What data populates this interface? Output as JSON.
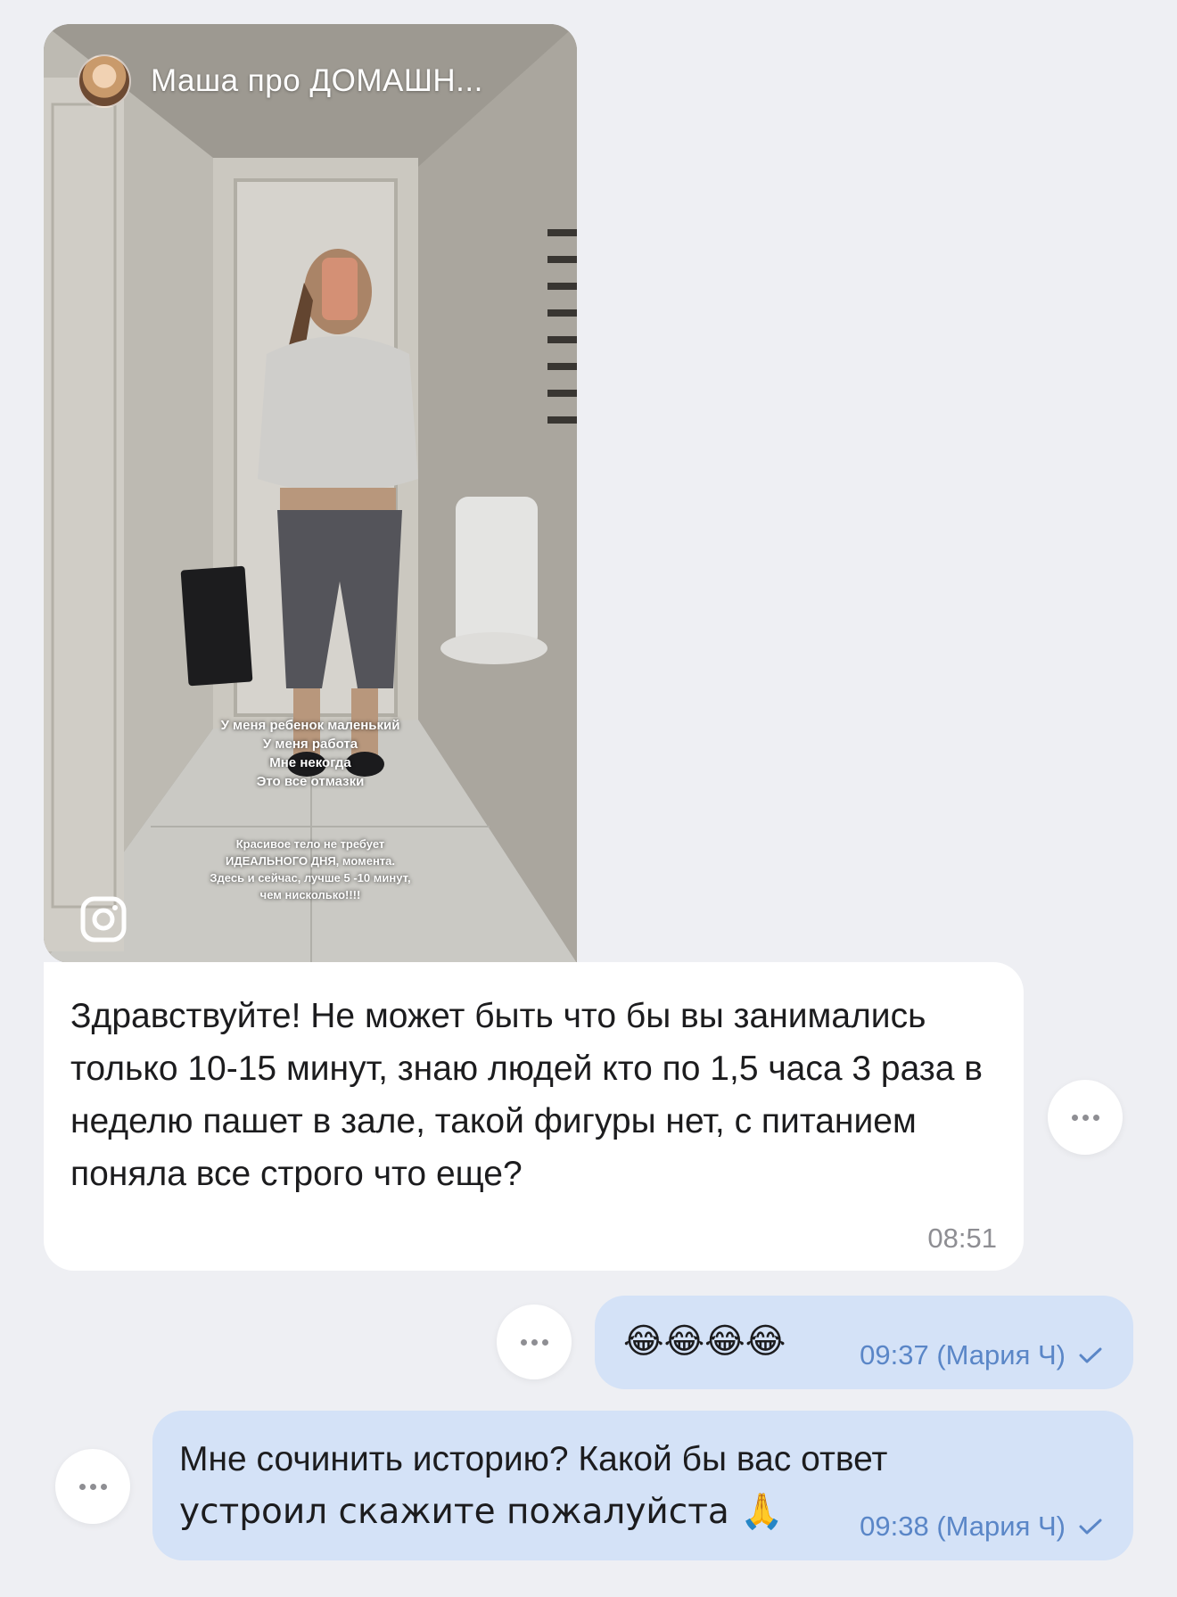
{
  "story": {
    "title": "Маша про ДОМАШН...",
    "caption_lines": [
      "У меня ребенок маленький",
      "У меня работа",
      "Мне некогда",
      "Это все отмазки"
    ],
    "caption2_lines": [
      "Красивое тело не требует",
      "ИДЕАЛЬНОГО ДНЯ, момента.",
      "Здесь и сейчас, лучше 5 -10 минут,",
      "чем нисколько!!!!"
    ],
    "source_icon": "instagram-icon"
  },
  "messages": [
    {
      "direction": "in",
      "text": "Здравствуйте! Не может быть что бы вы занимались только 10-15 минут, знаю людей кто по 1,5 часа 3 раза в неделю пашет в зале, такой фигуры нет, с питанием поняла все строго что еще?",
      "time": "08:51"
    },
    {
      "direction": "out",
      "text": "😂😂😂😂",
      "meta": "09:37 (Мария Ч)"
    },
    {
      "direction": "out",
      "text_line1": "Мне сочинить историю? Какой бы вас ответ",
      "text_line2": "устроил скажите пожалуйста 🙏",
      "meta": "09:38 (Мария Ч)"
    }
  ],
  "colors": {
    "background": "#eeeff3",
    "incoming_bubble": "#ffffff",
    "outgoing_bubble": "#d4e2f7",
    "outgoing_meta": "#5a86c7",
    "time_gray": "#8e8e93"
  }
}
